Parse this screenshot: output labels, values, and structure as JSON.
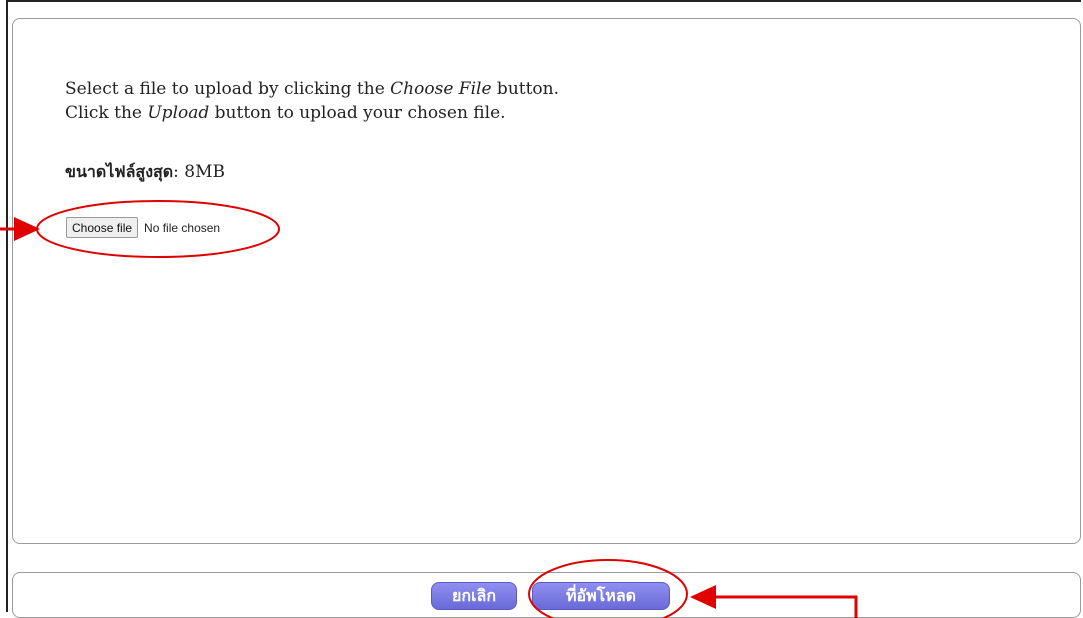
{
  "instructions": {
    "line1_prefix": "Select a file to upload by clicking the ",
    "line1_em": "Choose File",
    "line1_suffix": " button.",
    "line2_prefix": "Click the ",
    "line2_em": "Upload",
    "line2_suffix": " button to upload your chosen file."
  },
  "max_size": {
    "label": "ขนาดไฟล์สูงสุด",
    "value": ": 8MB"
  },
  "file_input": {
    "button_label": "Choose file",
    "status": "No file chosen"
  },
  "footer": {
    "cancel_label": "ยกเลิก",
    "upload_label": "ที่อัพโหลด"
  },
  "colors": {
    "annotation": "#e00000",
    "button": "#7b7be6"
  },
  "annotations": [
    "arrow-pointing-to-file-input",
    "circle-around-file-input",
    "circle-around-upload-button",
    "arrow-pointing-to-upload-button"
  ]
}
